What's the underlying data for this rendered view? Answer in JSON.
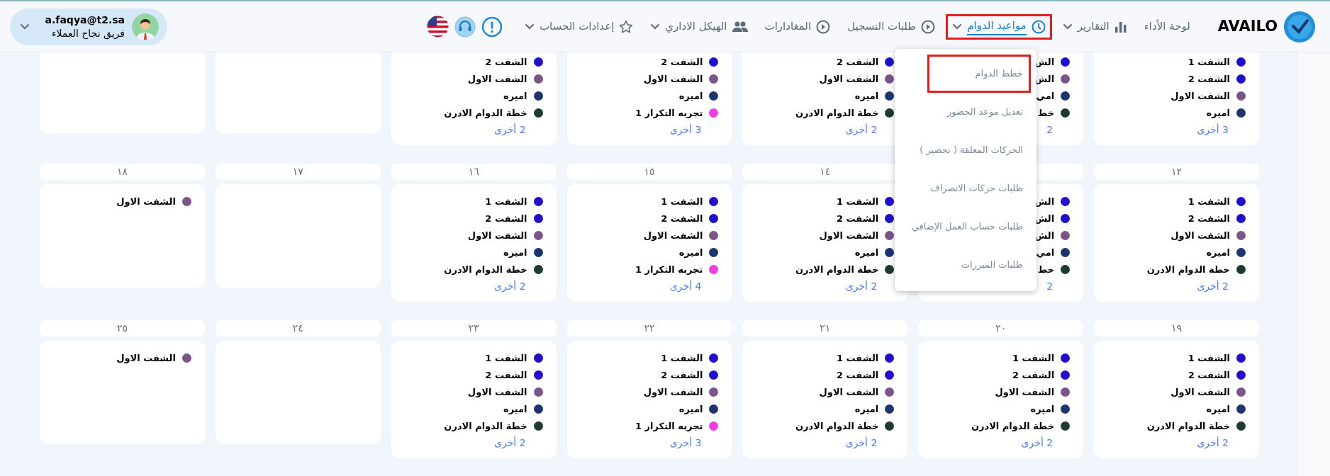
{
  "header": {
    "logo": "AVAILO",
    "nav": [
      {
        "label": "لوحة الأداء",
        "has_menu": false,
        "active": false,
        "highlighted": false
      },
      {
        "label": "التقارير",
        "has_menu": true,
        "active": false,
        "highlighted": false
      },
      {
        "label": "مواعيد الدوام",
        "has_menu": true,
        "active": true,
        "highlighted": true
      },
      {
        "label": "طلبات التسجيل",
        "has_menu": false,
        "active": false,
        "highlighted": false
      },
      {
        "label": "المغادارات",
        "has_menu": false,
        "active": false,
        "highlighted": false
      },
      {
        "label": "الهيكل الاداري",
        "has_menu": true,
        "active": false,
        "highlighted": false
      },
      {
        "label": "إعدادات الحساب",
        "has_menu": true,
        "active": false,
        "highlighted": false
      }
    ],
    "user": {
      "email": "a.faqya@t2.sa",
      "team": "فريق نجاح العملاء"
    }
  },
  "dropdown": {
    "items": [
      {
        "label": "خطط الدوام",
        "highlighted": true
      },
      {
        "label": "تعديل موعد الحضور",
        "highlighted": false
      },
      {
        "label": "الحركات المعلقة ( تحضير )",
        "highlighted": false
      },
      {
        "label": "طلبات حركات الانصراف",
        "highlighted": false
      },
      {
        "label": "طلبات حساب العمل الإضافي",
        "highlighted": false
      },
      {
        "label": "طلبات المبررات",
        "highlighted": false
      }
    ]
  },
  "weeks": [
    {
      "days": [
        {
          "events": [
            {
              "label": "الشفت 1",
              "color": "#1e0fcf"
            },
            {
              "label": "الشفت 2",
              "color": "#1e0fcf"
            },
            {
              "label": "الشفت الاول",
              "color": "#7c5488"
            },
            {
              "label": "اميره",
              "color": "#1c3470"
            }
          ],
          "more": "3 أخرى"
        },
        {
          "events": [
            {
              "label": "الش",
              "color": "#1e0fcf"
            },
            {
              "label": "الش",
              "color": "#7c5488"
            },
            {
              "label": "امي",
              "color": "#1c3470"
            },
            {
              "label": "خط",
              "color": "#1f3a2e"
            }
          ],
          "more": "2"
        },
        {
          "events": [
            {
              "label": "الشفت 2",
              "color": "#1e0fcf"
            },
            {
              "label": "الشفت الاول",
              "color": "#7c5488"
            },
            {
              "label": "اميره",
              "color": "#1c3470"
            },
            {
              "label": "خطة الدوام الادرن",
              "color": "#1f3a2e"
            }
          ],
          "more": "2 أخرى"
        },
        {
          "events": [
            {
              "label": "الشفت 2",
              "color": "#1e0fcf"
            },
            {
              "label": "الشفت الاول",
              "color": "#7c5488"
            },
            {
              "label": "اميره",
              "color": "#1c3470"
            },
            {
              "label": "تجربه التكرار 1",
              "color": "#f23ce6"
            }
          ],
          "more": "3 أخرى"
        },
        {
          "events": [
            {
              "label": "الشفت 2",
              "color": "#1e0fcf"
            },
            {
              "label": "الشفت الاول",
              "color": "#7c5488"
            },
            {
              "label": "اميره",
              "color": "#1c3470"
            },
            {
              "label": "خطة الدوام الادرن",
              "color": "#1f3a2e"
            }
          ],
          "more": "2 أخرى"
        },
        {
          "kind": "blank"
        },
        {
          "kind": "blank"
        }
      ]
    },
    {
      "days": [
        {
          "day": "١٢",
          "events": [
            {
              "label": "الشفت 1",
              "color": "#1e0fcf"
            },
            {
              "label": "الشفت 2",
              "color": "#1e0fcf"
            },
            {
              "label": "الشفت الاول",
              "color": "#7c5488"
            },
            {
              "label": "اميره",
              "color": "#1c3470"
            },
            {
              "label": "خطة الدوام الادرن",
              "color": "#1f3a2e"
            }
          ],
          "more": "2 أخرى"
        },
        {
          "events": [
            {
              "label": "الش",
              "color": "#1e0fcf"
            },
            {
              "label": "الش",
              "color": "#1e0fcf"
            },
            {
              "label": "الش",
              "color": "#7c5488"
            },
            {
              "label": "امي",
              "color": "#1c3470"
            },
            {
              "label": "خط",
              "color": "#1f3a2e"
            }
          ],
          "more": "2"
        },
        {
          "day": "١٤",
          "events": [
            {
              "label": "الشفت 1",
              "color": "#1e0fcf"
            },
            {
              "label": "الشفت 2",
              "color": "#1e0fcf"
            },
            {
              "label": "الشفت الاول",
              "color": "#7c5488"
            },
            {
              "label": "اميره",
              "color": "#1c3470"
            },
            {
              "label": "خطة الدوام الادرن",
              "color": "#1f3a2e"
            }
          ],
          "more": "2 أخرى"
        },
        {
          "day": "١٥",
          "events": [
            {
              "label": "الشفت 1",
              "color": "#1e0fcf"
            },
            {
              "label": "الشفت 2",
              "color": "#1e0fcf"
            },
            {
              "label": "الشفت الاول",
              "color": "#7c5488"
            },
            {
              "label": "اميره",
              "color": "#1c3470"
            },
            {
              "label": "تجربه التكرار 1",
              "color": "#f23ce6"
            }
          ],
          "more": "4 أخرى"
        },
        {
          "day": "١٦",
          "events": [
            {
              "label": "الشفت 1",
              "color": "#1e0fcf"
            },
            {
              "label": "الشفت 2",
              "color": "#1e0fcf"
            },
            {
              "label": "الشفت الاول",
              "color": "#7c5488"
            },
            {
              "label": "اميره",
              "color": "#1c3470"
            },
            {
              "label": "خطة الدوام الادرن",
              "color": "#1f3a2e"
            }
          ],
          "more": "2 أخرى"
        },
        {
          "day": "١٧"
        },
        {
          "day": "١٨",
          "events": [
            {
              "label": "الشفت الاول",
              "color": "#7c5488"
            }
          ]
        }
      ]
    },
    {
      "days": [
        {
          "day": "١٩",
          "events": [
            {
              "label": "الشفت 1",
              "color": "#1e0fcf"
            },
            {
              "label": "الشفت 2",
              "color": "#1e0fcf"
            },
            {
              "label": "الشفت الاول",
              "color": "#7c5488"
            },
            {
              "label": "اميره",
              "color": "#1c3470"
            },
            {
              "label": "خطة الدوام الادرن",
              "color": "#1f3a2e"
            }
          ],
          "more": "2 أخرى"
        },
        {
          "day": "٢٠",
          "events": [
            {
              "label": "الشفت 1",
              "color": "#1e0fcf"
            },
            {
              "label": "الشفت 2",
              "color": "#1e0fcf"
            },
            {
              "label": "الشفت الاول",
              "color": "#7c5488"
            },
            {
              "label": "اميره",
              "color": "#1c3470"
            },
            {
              "label": "خطة الدوام الادرن",
              "color": "#1f3a2e"
            }
          ],
          "more": "2 أخرى"
        },
        {
          "day": "٢١",
          "events": [
            {
              "label": "الشفت 1",
              "color": "#1e0fcf"
            },
            {
              "label": "الشفت 2",
              "color": "#1e0fcf"
            },
            {
              "label": "الشفت الاول",
              "color": "#7c5488"
            },
            {
              "label": "اميره",
              "color": "#1c3470"
            },
            {
              "label": "خطة الدوام الادرن",
              "color": "#1f3a2e"
            }
          ],
          "more": "2 أخرى"
        },
        {
          "day": "٢٢",
          "events": [
            {
              "label": "الشفت 1",
              "color": "#1e0fcf"
            },
            {
              "label": "الشفت 2",
              "color": "#1e0fcf"
            },
            {
              "label": "الشفت الاول",
              "color": "#7c5488"
            },
            {
              "label": "اميره",
              "color": "#1c3470"
            },
            {
              "label": "تجربه التكرار 1",
              "color": "#f23ce6"
            }
          ],
          "more": "3 أخرى"
        },
        {
          "day": "٢٣",
          "events": [
            {
              "label": "الشفت 1",
              "color": "#1e0fcf"
            },
            {
              "label": "الشفت 2",
              "color": "#1e0fcf"
            },
            {
              "label": "الشفت الاول",
              "color": "#7c5488"
            },
            {
              "label": "اميره",
              "color": "#1c3470"
            },
            {
              "label": "خطة الدوام الادرن",
              "color": "#1f3a2e"
            }
          ],
          "more": "2 أخرى"
        },
        {
          "day": "٢٤"
        },
        {
          "day": "٢٥",
          "events": [
            {
              "label": "الشفت الاول",
              "color": "#7c5488"
            }
          ]
        }
      ]
    }
  ]
}
